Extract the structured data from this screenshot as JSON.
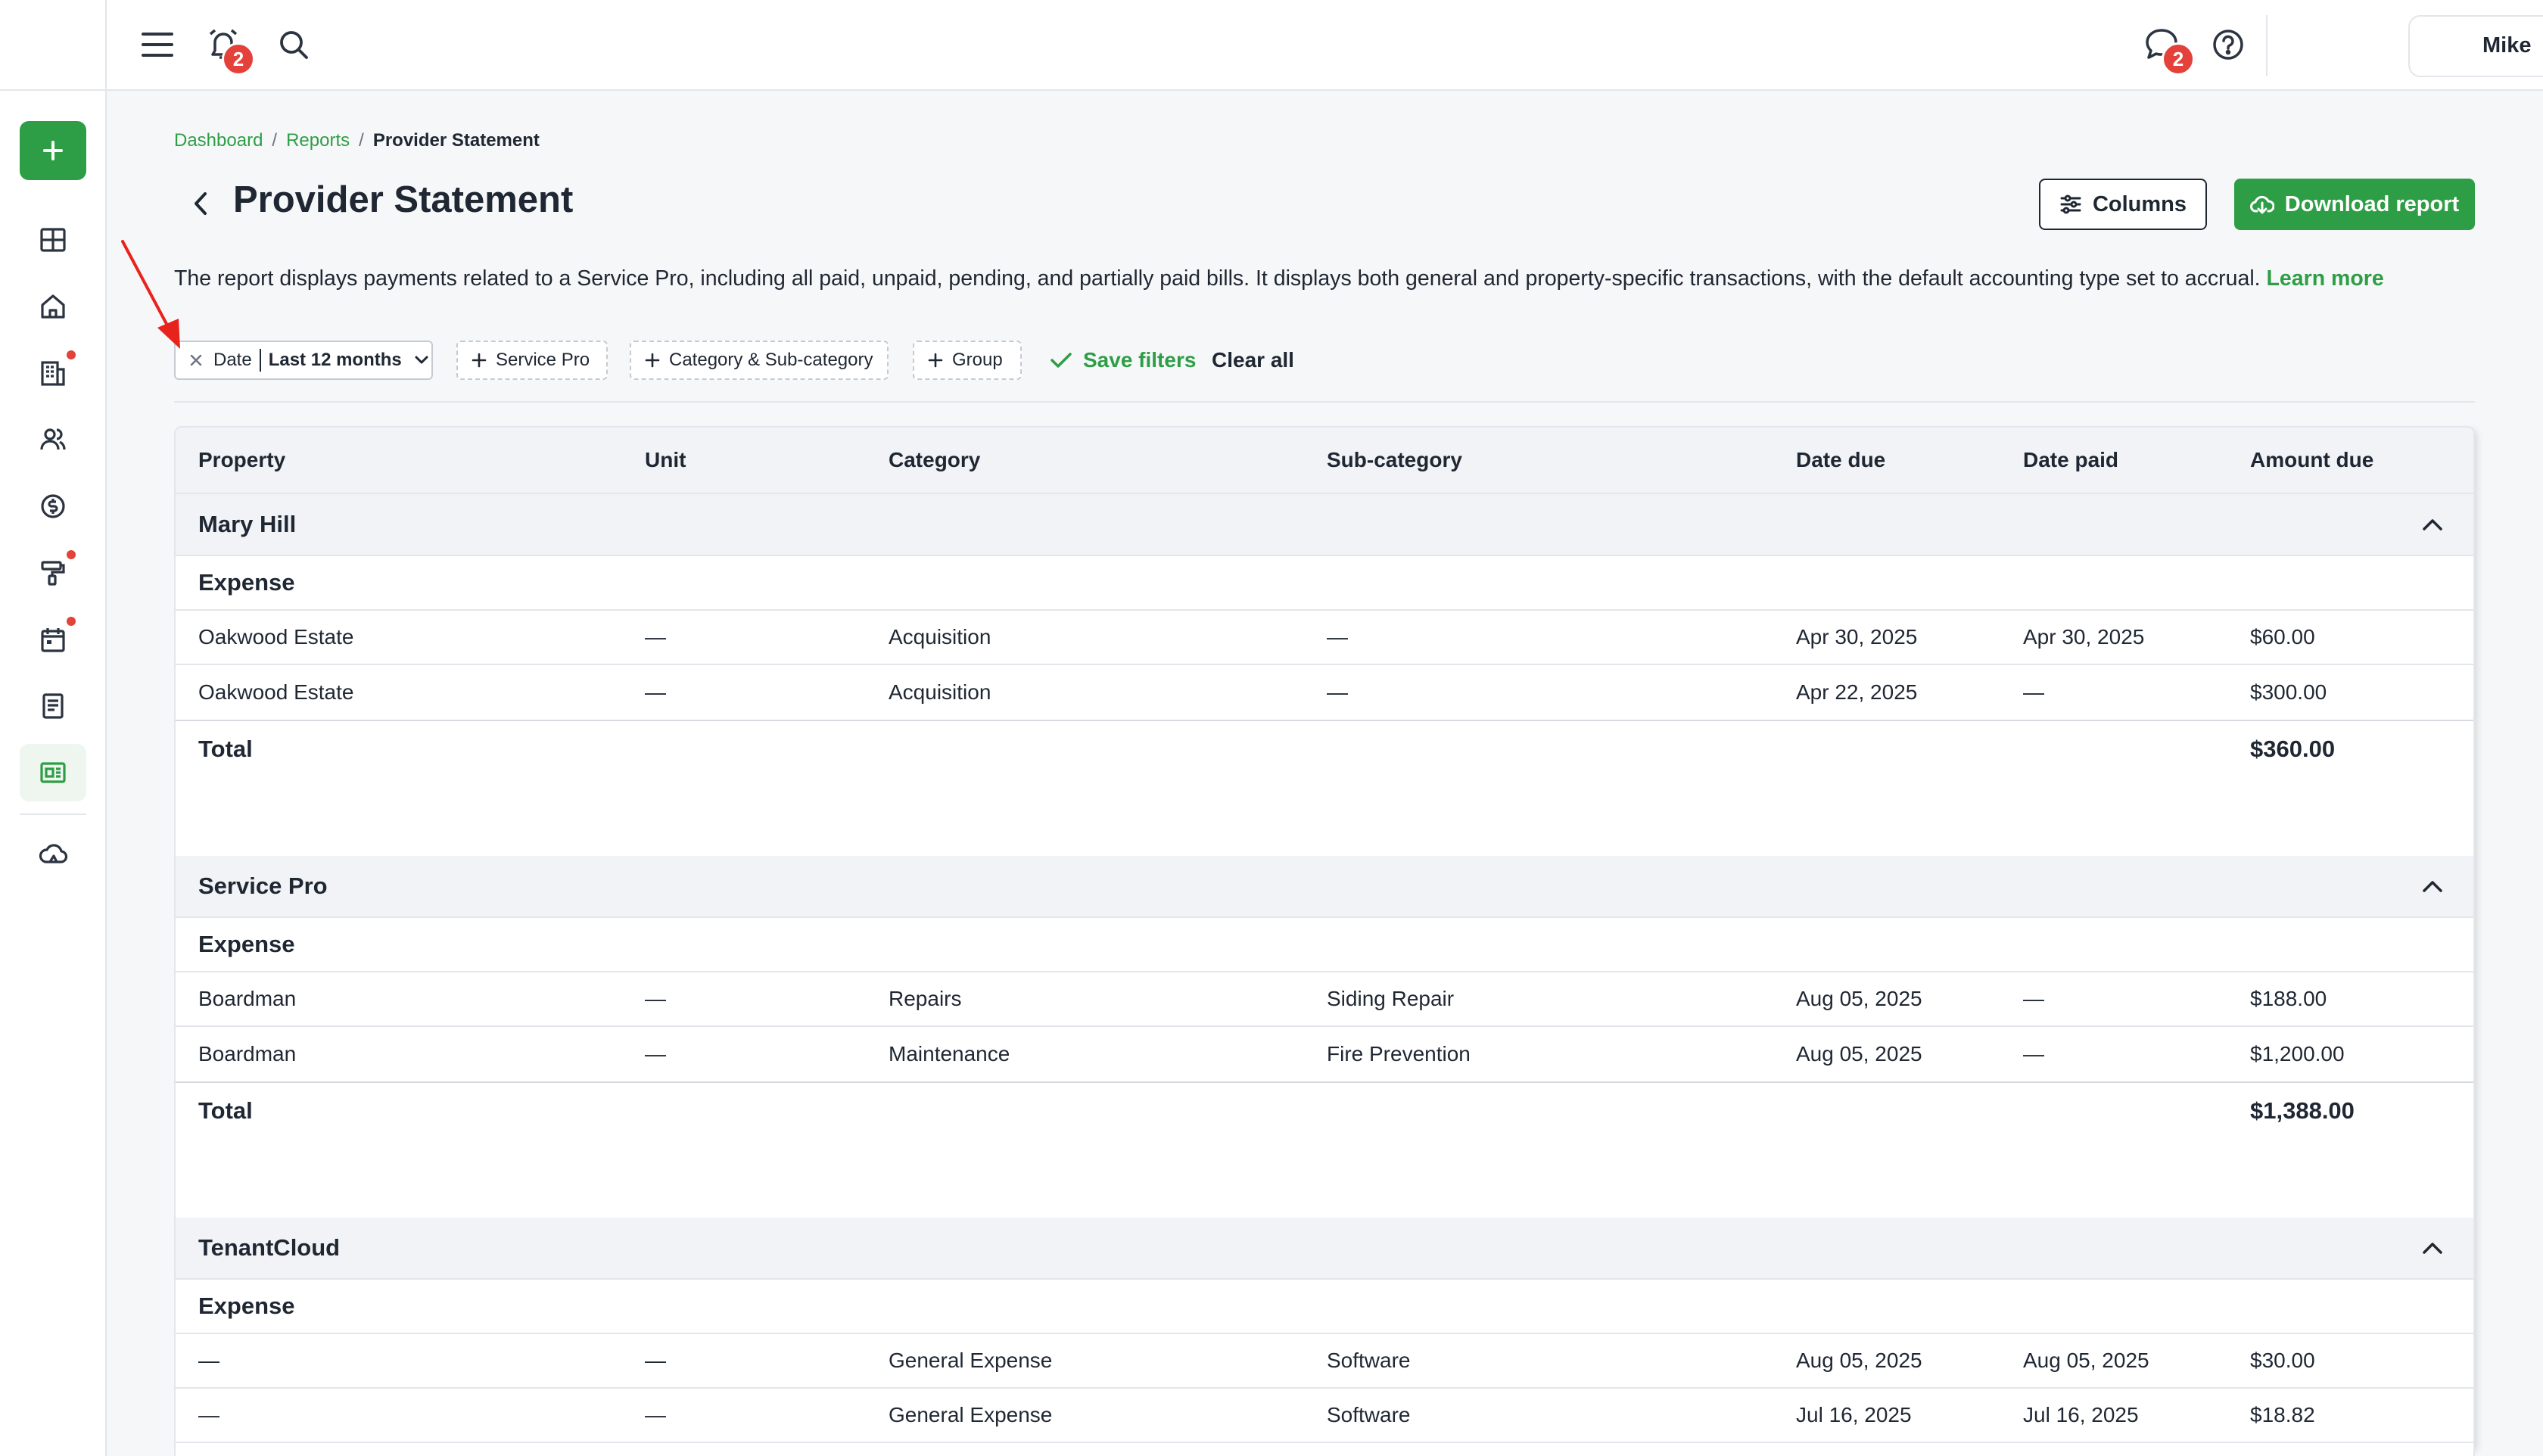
{
  "topbar": {
    "menu_icon": "hamburger-menu-icon",
    "alarm_icon": "alarm-bell-icon",
    "alarm_badge": "2",
    "search_icon": "search-icon",
    "chat_icon": "chat-bubble-icon",
    "chat_badge": "2",
    "help_icon": "help-circle-icon",
    "user_name": "Mike"
  },
  "sidebar": {
    "add_icon": "plus-icon",
    "items": [
      {
        "icon": "dashboard-grid-icon",
        "active": false,
        "dot": false
      },
      {
        "icon": "home-icon",
        "active": false,
        "dot": false
      },
      {
        "icon": "building-icon",
        "active": false,
        "dot": true
      },
      {
        "icon": "people-icon",
        "active": false,
        "dot": false
      },
      {
        "icon": "dollar-circle-icon",
        "active": false,
        "dot": false
      },
      {
        "icon": "paint-roller-icon",
        "active": false,
        "dot": true
      },
      {
        "icon": "calendar-icon",
        "active": false,
        "dot": true
      },
      {
        "icon": "document-icon",
        "active": false,
        "dot": false
      },
      {
        "icon": "report-icon",
        "active": true,
        "dot": false
      },
      {
        "icon": "cloud-icon",
        "active": false,
        "dot": false
      }
    ]
  },
  "breadcrumb": {
    "items": [
      "Dashboard",
      "Reports"
    ],
    "separator": "/",
    "current": "Provider Statement"
  },
  "page": {
    "title": "Provider Statement",
    "columns_label": "Columns",
    "download_label": "Download report",
    "description": "The report displays payments related to a Service Pro, including all paid, unpaid, pending, and partially paid bills. It displays both general and property-specific transactions, with the default accounting type set to accrual.",
    "learn_more": "Learn more"
  },
  "filters": {
    "date_label": "Date",
    "date_value": "Last 12 months",
    "chips": [
      "Service Pro",
      "Category & Sub-category",
      "Group"
    ],
    "save_label": "Save filters",
    "clear_label": "Clear all"
  },
  "table": {
    "columns": [
      "Property",
      "Unit",
      "Category",
      "Sub-category",
      "Date due",
      "Date paid",
      "Amount due"
    ],
    "total_label": "Total",
    "groups": [
      {
        "name": "Mary Hill",
        "section": "Expense",
        "rows": [
          [
            "Oakwood Estate",
            "—",
            "Acquisition",
            "—",
            "Apr 30, 2025",
            "Apr 30, 2025",
            "$60.00"
          ],
          [
            "Oakwood Estate",
            "—",
            "Acquisition",
            "—",
            "Apr 22, 2025",
            "—",
            "$300.00"
          ]
        ],
        "total": "$360.00"
      },
      {
        "name": "Service Pro",
        "section": "Expense",
        "rows": [
          [
            "Boardman",
            "—",
            "Repairs",
            "Siding Repair",
            "Aug 05, 2025",
            "—",
            "$188.00"
          ],
          [
            "Boardman",
            "—",
            "Maintenance",
            "Fire Prevention",
            "Aug 05, 2025",
            "—",
            "$1,200.00"
          ]
        ],
        "total": "$1,388.00"
      },
      {
        "name": "TenantCloud",
        "section": "Expense",
        "rows": [
          [
            "—",
            "—",
            "General Expense",
            "Software",
            "Aug 05, 2025",
            "Aug 05, 2025",
            "$30.00"
          ],
          [
            "—",
            "—",
            "General Expense",
            "Software",
            "Jul 16, 2025",
            "Jul 16, 2025",
            "$18.82"
          ]
        ]
      }
    ]
  },
  "colors": {
    "accent": "#2e9e46",
    "badge": "#e4413a",
    "annotation": "#e8231c",
    "text": "#1f2733"
  }
}
